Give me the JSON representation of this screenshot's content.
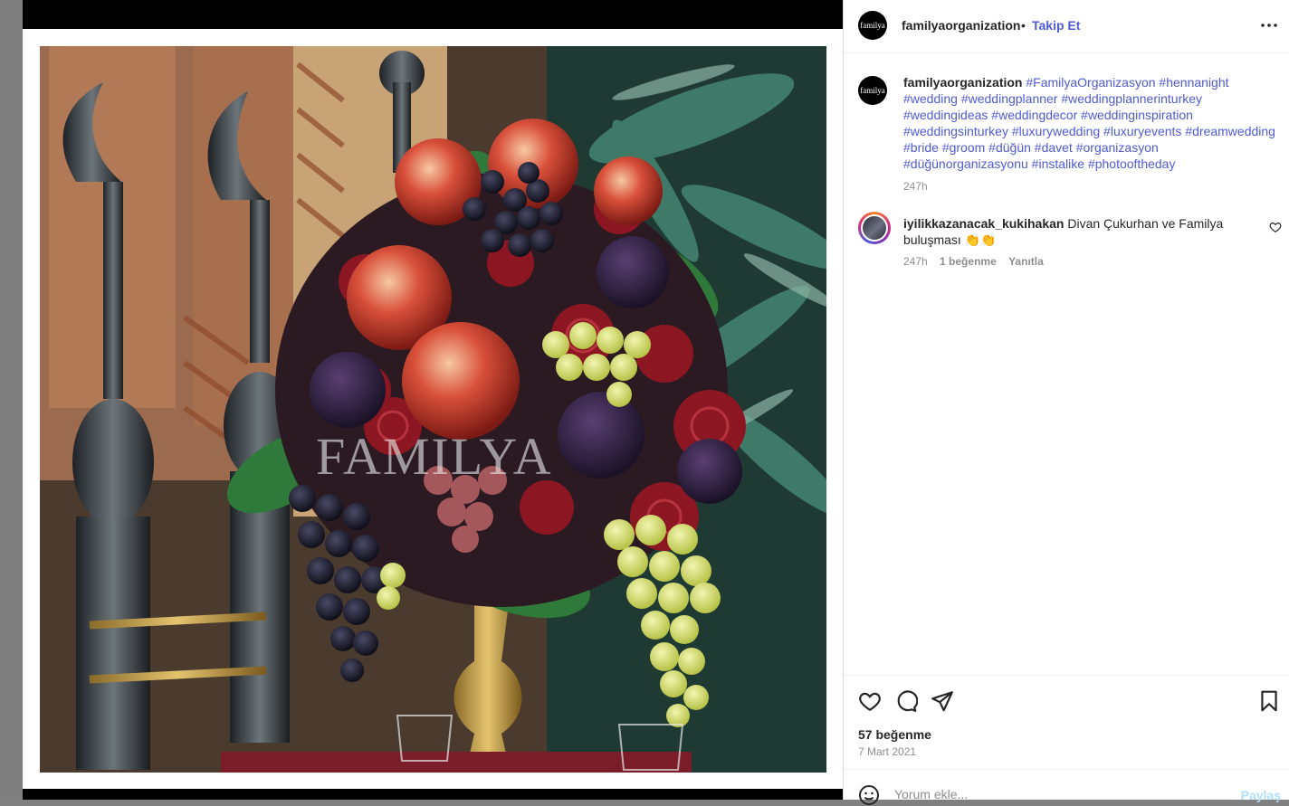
{
  "post": {
    "media": {
      "watermark": "FAMILYA",
      "avatar_text": "familya"
    },
    "header": {
      "username": "familyaorganization",
      "separator": "•",
      "follow_label": "Takip Et",
      "more_icon": "ellipsis-icon"
    },
    "caption": {
      "username": "familyaorganization",
      "hashtags": [
        "#FamilyaOrganizasyon",
        "#hennanight",
        "#wedding",
        "#weddingplanner",
        "#weddingplannerinturkey",
        "#weddingideas",
        "#weddingdecor",
        "#weddinginspiration",
        "#weddingsinturkey",
        "#luxurywedding",
        "#luxuryevents",
        "#dreamwedding",
        "#bride",
        "#groom",
        "#düğün",
        "#davet",
        "#organizasyon",
        "#düğünorganizasyonu",
        "#instalike",
        "#photooftheday"
      ],
      "time": "247h"
    },
    "comments": [
      {
        "username": "iyilikkazanacak_kukihakan",
        "text": "Divan Çukurhan ve Familya buluşması 👏👏",
        "time": "247h",
        "likes": "1 beğenme",
        "reply": "Yanıtla"
      }
    ],
    "actions": [
      "heart-icon",
      "comment-icon",
      "share-icon",
      "bookmark-icon"
    ],
    "likes": "57 beğenme",
    "date": "7 Mart 2021",
    "add_comment": {
      "placeholder": "Yorum ekle...",
      "share_label": "Paylaş"
    },
    "colors": {
      "link": "#4f5bd5",
      "muted": "#8e8e8e",
      "share_disabled": "#b2dffc"
    }
  }
}
